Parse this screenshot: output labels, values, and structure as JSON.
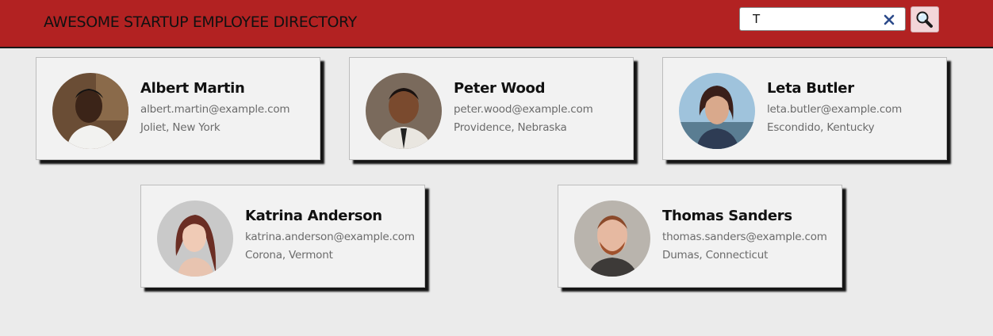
{
  "header": {
    "title": "AWESOME STARTUP EMPLOYEE DIRECTORY",
    "search_value": "T",
    "clear_icon": "close-icon",
    "search_icon": "magnifier-icon"
  },
  "colors": {
    "header_bg": "#b22222",
    "page_bg": "#ebebeb",
    "card_bg": "#f2f2f2",
    "clear_icon": "#2c4a8a",
    "search_button_bg": "#f3d6d9"
  },
  "employees": [
    {
      "name": "Albert Martin",
      "email": "albert.martin@example.com",
      "location": "Joliet, New York",
      "avatar": "avatar-photo"
    },
    {
      "name": "Peter Wood",
      "email": "peter.wood@example.com",
      "location": "Providence, Nebraska",
      "avatar": "avatar-photo"
    },
    {
      "name": "Leta Butler",
      "email": "leta.butler@example.com",
      "location": "Escondido, Kentucky",
      "avatar": "avatar-photo"
    },
    {
      "name": "Katrina Anderson",
      "email": "katrina.anderson@example.com",
      "location": "Corona, Vermont",
      "avatar": "avatar-photo"
    },
    {
      "name": "Thomas Sanders",
      "email": "thomas.sanders@example.com",
      "location": "Dumas, Connecticut",
      "avatar": "avatar-photo"
    }
  ]
}
